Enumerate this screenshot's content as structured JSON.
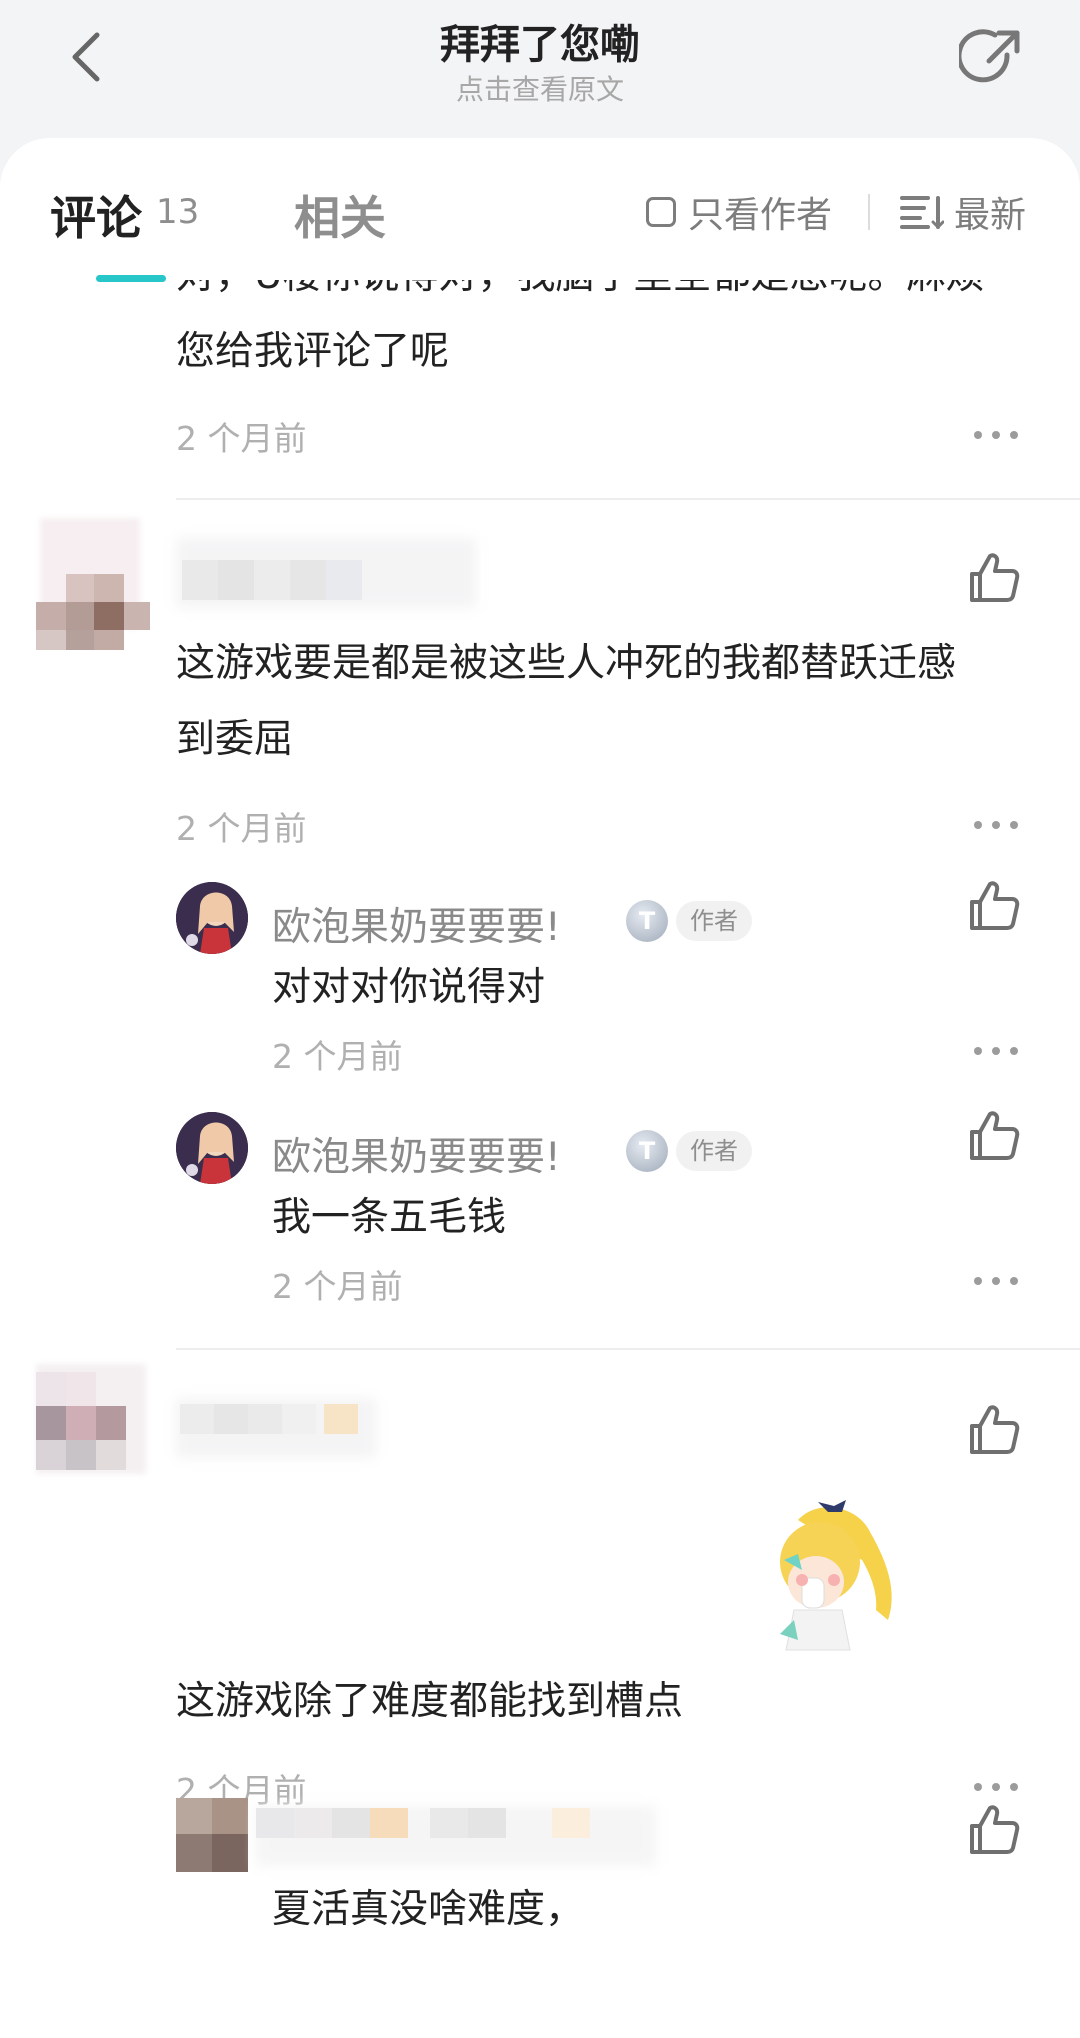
{
  "header": {
    "title": "拜拜了您嘞",
    "subtitle": "点击查看原文"
  },
  "tabs": {
    "comments_label": "评论",
    "comments_count": "13",
    "related_label": "相关",
    "only_author_label": "只看作者",
    "sort_label": "最新"
  },
  "comments": [
    {
      "text_partial": "对，U楼你说得对，我脑子里全都是想呢。麻烦",
      "text_line2": "您给我评论了呢",
      "time": "2 个月前"
    },
    {
      "text_line1": "这游戏要是都是被这些人冲死的我都替跃迁感",
      "text_line2": "到委屈",
      "time": "2 个月前",
      "replies": [
        {
          "username": "欧泡果奶要要要!",
          "level": "T",
          "author_tag": "作者",
          "text": "对对对你说得对",
          "time": "2 个月前"
        },
        {
          "username": "欧泡果奶要要要!",
          "level": "T",
          "author_tag": "作者",
          "text": "我一条五毛钱",
          "time": "2 个月前"
        }
      ]
    },
    {
      "text": "这游戏除了难度都能找到槽点",
      "time": "2 个月前",
      "reply_partial": "夏活真没啥难度，"
    }
  ],
  "colors": {
    "accent": "#26c6c9",
    "background": "#f3f4f6"
  }
}
